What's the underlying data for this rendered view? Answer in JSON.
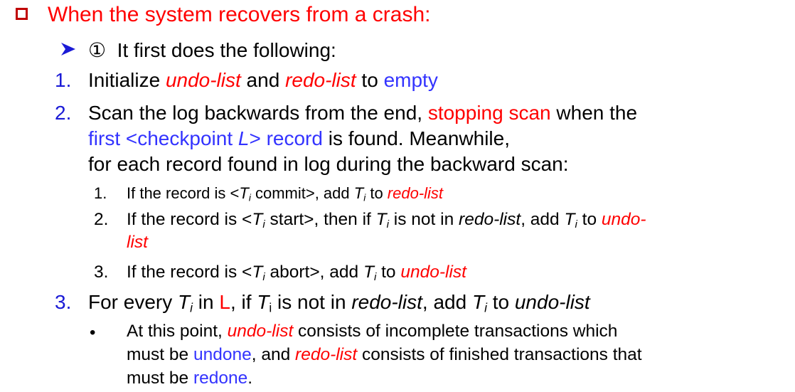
{
  "heading": {
    "text": "When the system recovers from a crash:"
  },
  "step": {
    "circle": "①",
    "text": "It first does the following:"
  },
  "items": [
    {
      "num": "1.",
      "p1": "Initialize ",
      "r1": "undo-list",
      "p2": " and ",
      "r2": "redo-list",
      "p3": " to ",
      "b1": "empty"
    },
    {
      "num": "2.",
      "line1_a": "Scan the log backwards from the end, ",
      "line1_r": "stopping scan",
      "line1_b": " when the",
      "line2_b1": "first <checkpoint ",
      "line2_bi": "L",
      "line2_b2": "> record",
      "line2_t": " is found.  Meanwhile,",
      "line3": "for each record found in log during the backward scan:",
      "sub": [
        {
          "num": "1.",
          "a": "If the record is <",
          "T": "T",
          "i": "i",
          "b": " commit>, add ",
          "T2": "T",
          "i2": "i",
          "c": " to ",
          "red": "redo-list"
        },
        {
          "num": "2.",
          "a": "If the record is <",
          "T": "T",
          "i": "i",
          "b": " start>, then if ",
          "T2": "T",
          "i2": "i",
          "c": " is not in ",
          "it": "redo-list",
          "d": ", add ",
          "T3": "T",
          "i3": "i",
          "e": " to ",
          "red1": "undo-",
          "red2": "list"
        },
        {
          "num": "3.",
          "a": "If the record is <",
          "T": "T",
          "i": "i",
          "b": " abort>, add ",
          "T2": "T",
          "i2": "i",
          "c": " to ",
          "red": "undo-list"
        }
      ]
    },
    {
      "num": "3.",
      "a": "For every ",
      "T": "T",
      "i": "i",
      "b": " in ",
      "L": "L",
      "c": ", if ",
      "T2": "T",
      "i2": "i",
      "d": " is not in ",
      "it1": "redo-list",
      "e": ", add ",
      "T3": "T",
      "i3": "i",
      "f": " to ",
      "it2": "undo-list",
      "bullet": {
        "line1_a": "At this point, ",
        "line1_r": "undo-list",
        "line1_b": " consists of incomplete transactions which",
        "line2_a": "must be ",
        "line2_b": "undone",
        "line2_c": ", and ",
        "line2_r": "redo-list",
        "line2_d": " consists of finished transactions that",
        "line3_a": "must be ",
        "line3_b": "redone",
        "line3_c": "."
      }
    }
  ]
}
